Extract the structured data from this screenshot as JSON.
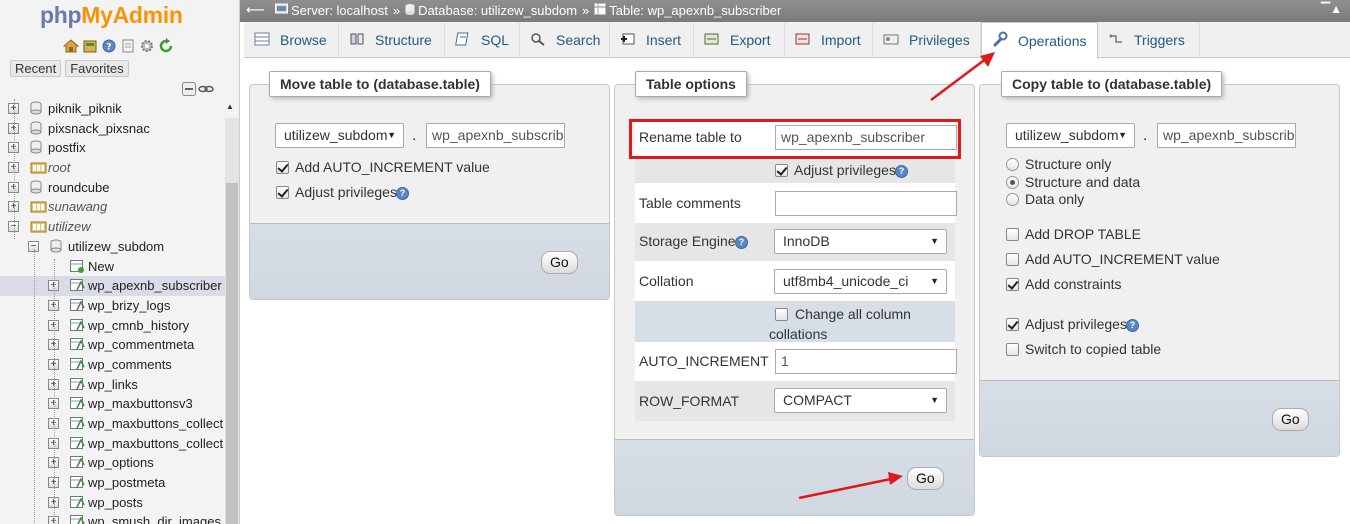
{
  "app": {
    "logo_php": "php",
    "logo_ma": "MyAdmin",
    "nav_tabs": [
      "Recent",
      "Favorites"
    ],
    "nav_icons": [
      "home-icon",
      "database-icon",
      "help-icon",
      "docs-icon",
      "settings-icon",
      "reload-icon"
    ]
  },
  "tree": [
    {
      "label": "piknik_piknik",
      "italic": false,
      "level": 0
    },
    {
      "label": "pixsnack_pixsnac",
      "italic": false,
      "level": 0
    },
    {
      "label": "postfix",
      "italic": false,
      "level": 0
    },
    {
      "label": "root",
      "italic": true,
      "level": 0
    },
    {
      "label": "roundcube",
      "italic": false,
      "level": 0
    },
    {
      "label": "sunawang",
      "italic": true,
      "level": 0
    },
    {
      "label": "utilizew",
      "italic": true,
      "level": 0
    },
    {
      "label": "utilizew_subdom",
      "italic": false,
      "level": 1
    },
    {
      "label": "New",
      "italic": false,
      "level": 2
    },
    {
      "label": "wp_apexnb_subscriber",
      "italic": false,
      "level": 2,
      "selected": true
    },
    {
      "label": "wp_brizy_logs",
      "italic": false,
      "level": 2
    },
    {
      "label": "wp_cmnb_history",
      "italic": false,
      "level": 2
    },
    {
      "label": "wp_commentmeta",
      "italic": false,
      "level": 2
    },
    {
      "label": "wp_comments",
      "italic": false,
      "level": 2
    },
    {
      "label": "wp_links",
      "italic": false,
      "level": 2
    },
    {
      "label": "wp_maxbuttonsv3",
      "italic": false,
      "level": 2
    },
    {
      "label": "wp_maxbuttons_collect",
      "italic": false,
      "level": 2
    },
    {
      "label": "wp_maxbuttons_collect",
      "italic": false,
      "level": 2
    },
    {
      "label": "wp_options",
      "italic": false,
      "level": 2
    },
    {
      "label": "wp_postmeta",
      "italic": false,
      "level": 2
    },
    {
      "label": "wp_posts",
      "italic": false,
      "level": 2
    },
    {
      "label": "wp_smush_dir_images",
      "italic": false,
      "level": 2
    }
  ],
  "breadcrumb": {
    "server": "Server: localhost",
    "sep": "»",
    "database": "Database: utilizew_subdom",
    "table": "Table: wp_apexnb_subscriber"
  },
  "tabs": [
    "Browse",
    "Structure",
    "SQL",
    "Search",
    "Insert",
    "Export",
    "Import",
    "Privileges",
    "Operations",
    "Triggers"
  ],
  "active_tab": "Operations",
  "move_table": {
    "legend": "Move table to (database.table)",
    "database": "utilizew_subdom",
    "dot": ".",
    "table_name": "wp_apexnb_subscribe",
    "add_auto_increment": "Add AUTO_INCREMENT value",
    "adjust_privileges": "Adjust privileges",
    "go": "Go"
  },
  "table_options": {
    "legend": "Table options",
    "rename_label": "Rename table to",
    "rename_value": "wp_apexnb_subscriber",
    "adjust_privileges": "Adjust privileges",
    "comments_label": "Table comments",
    "comments_value": "",
    "engine_label": "Storage Engine",
    "engine_value": "InnoDB",
    "collation_label": "Collation",
    "collation_value": "utf8mb4_unicode_ci",
    "change_all_line1": "Change all column",
    "change_all_line2": "collations",
    "auto_inc_label": "AUTO_INCREMENT",
    "auto_inc_value": "1",
    "row_format_label": "ROW_FORMAT",
    "row_format_value": "COMPACT",
    "go": "Go"
  },
  "copy_table": {
    "legend": "Copy table to (database.table)",
    "database": "utilizew_subdom",
    "dot": ".",
    "table_name": "wp_apexnb_subscribe",
    "structure_only": "Structure only",
    "structure_and_data": "Structure and data",
    "data_only": "Data only",
    "add_drop_table": "Add DROP TABLE",
    "add_auto_increment": "Add AUTO_INCREMENT value",
    "add_constraints": "Add constraints",
    "adjust_privileges": "Adjust privileges",
    "switch_to_copied": "Switch to copied table",
    "go": "Go"
  },
  "colors": {
    "highlight": "#e0191b",
    "link": "#235a81",
    "topbar": "#858585",
    "footer": "#d3dae3"
  }
}
